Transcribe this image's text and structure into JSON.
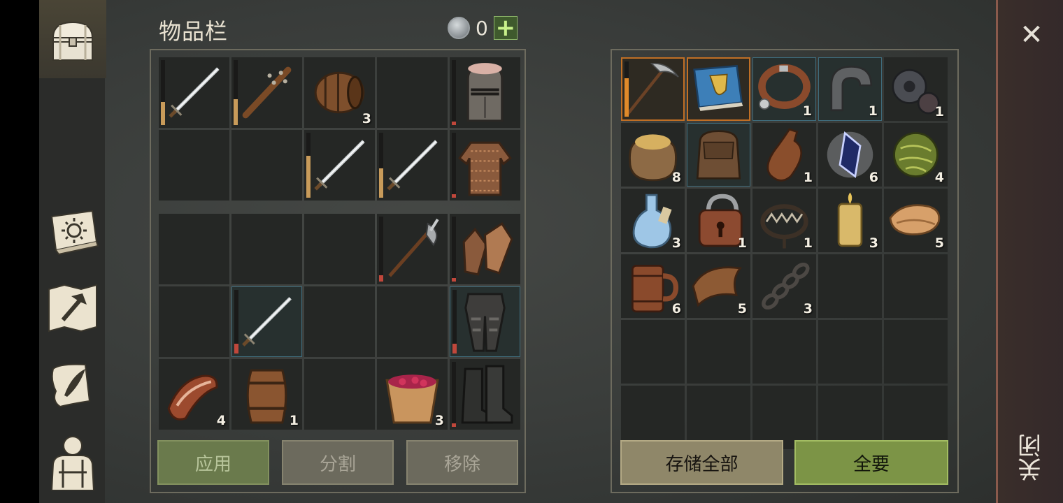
{
  "inventory": {
    "title": "物品栏",
    "currency": {
      "icon": "silver-coin-icon",
      "value": "0",
      "add": "+"
    },
    "equipped": [
      {
        "icon": "sword-icon",
        "count": "",
        "bar": 0.35,
        "bar_color": "#c89b5a"
      },
      {
        "icon": "spiked-club-icon",
        "count": "",
        "bar": 0.4,
        "bar_color": "#c89b5a"
      },
      {
        "icon": "barrel-icon",
        "count": "3",
        "bar": null,
        "bar_color": ""
      },
      {
        "icon": "",
        "count": "",
        "bar": null,
        "bar_color": ""
      },
      {
        "icon": "knight-helmet-icon",
        "count": "",
        "bar": 0.05,
        "bar_color": "#c0473b"
      },
      {
        "icon": "",
        "count": "",
        "bar": null,
        "bar_color": ""
      },
      {
        "icon": "",
        "count": "",
        "bar": null,
        "bar_color": ""
      },
      {
        "icon": "sword-icon",
        "count": "",
        "bar": 0.65,
        "bar_color": "#c89b5a"
      },
      {
        "icon": "sword-icon",
        "count": "",
        "bar": 0.45,
        "bar_color": "#c89b5a"
      },
      {
        "icon": "chainmail-shirt-icon",
        "count": "",
        "bar": 0.05,
        "bar_color": "#c0473b"
      }
    ],
    "backpack": [
      {
        "icon": "",
        "count": "",
        "bar": null,
        "bar_color": ""
      },
      {
        "icon": "",
        "count": "",
        "bar": null,
        "bar_color": ""
      },
      {
        "icon": "",
        "count": "",
        "bar": null,
        "bar_color": ""
      },
      {
        "icon": "halberd-icon",
        "count": "",
        "bar": 0.1,
        "bar_color": "#c0473b"
      },
      {
        "icon": "chainmail-gloves-icon",
        "count": "",
        "bar": 0.05,
        "bar_color": "#c0473b"
      },
      {
        "icon": "",
        "count": "",
        "bar": null,
        "bar_color": ""
      },
      {
        "icon": "sword-icon",
        "count": "",
        "bar": 0.15,
        "bar_color": "#c0473b",
        "sel": "blue"
      },
      {
        "icon": "",
        "count": "",
        "bar": null,
        "bar_color": ""
      },
      {
        "icon": "",
        "count": "",
        "bar": null,
        "bar_color": ""
      },
      {
        "icon": "armored-pants-icon",
        "count": "",
        "bar": 0.15,
        "bar_color": "#c0473b",
        "sel": "blue"
      },
      {
        "icon": "bacon-icon",
        "count": "4",
        "bar": null,
        "bar_color": ""
      },
      {
        "icon": "keg-icon",
        "count": "1",
        "bar": null,
        "bar_color": ""
      },
      {
        "icon": "",
        "count": "",
        "bar": null,
        "bar_color": ""
      },
      {
        "icon": "berry-bucket-icon",
        "count": "3",
        "bar": null,
        "bar_color": ""
      },
      {
        "icon": "leather-boots-icon",
        "count": "",
        "bar": 0.05,
        "bar_color": "#c0473b"
      }
    ],
    "buttons": {
      "apply": "应用",
      "split": "分割",
      "remove": "移除"
    }
  },
  "storage": {
    "items": [
      {
        "icon": "pickaxe-icon",
        "count": "",
        "sel": "orange",
        "bar": 0.7,
        "bar_color": "#e08a2a"
      },
      {
        "icon": "blue-book-icon",
        "count": "",
        "sel": "orange"
      },
      {
        "icon": "leather-collar-icon",
        "count": "1",
        "sel": "blue"
      },
      {
        "icon": "iron-clamp-icon",
        "count": "1",
        "sel": "blue"
      },
      {
        "icon": "gear-parts-icon",
        "count": "1"
      },
      {
        "icon": "grain-sack-icon",
        "count": "8"
      },
      {
        "icon": "leather-backpack-icon",
        "count": "",
        "sel": "blue"
      },
      {
        "icon": "clay-bottle-icon",
        "count": "1"
      },
      {
        "icon": "crystal-shard-icon",
        "count": "6"
      },
      {
        "icon": "herb-ball-icon",
        "count": "4"
      },
      {
        "icon": "potion-flask-icon",
        "count": "3"
      },
      {
        "icon": "padlock-icon",
        "count": "1"
      },
      {
        "icon": "bear-trap-icon",
        "count": "1"
      },
      {
        "icon": "candle-icon",
        "count": "3"
      },
      {
        "icon": "cloth-roll-icon",
        "count": "5"
      },
      {
        "icon": "wooden-mug-icon",
        "count": "6"
      },
      {
        "icon": "leather-scrap-icon",
        "count": "5"
      },
      {
        "icon": "chain-icon",
        "count": "3"
      },
      {
        "icon": "",
        "count": ""
      },
      {
        "icon": "",
        "count": ""
      },
      {
        "icon": "",
        "count": ""
      },
      {
        "icon": "",
        "count": ""
      },
      {
        "icon": "",
        "count": ""
      },
      {
        "icon": "",
        "count": ""
      },
      {
        "icon": "",
        "count": ""
      },
      {
        "icon": "",
        "count": ""
      },
      {
        "icon": "",
        "count": ""
      },
      {
        "icon": "",
        "count": ""
      },
      {
        "icon": "",
        "count": ""
      },
      {
        "icon": "",
        "count": ""
      }
    ],
    "buttons": {
      "store_all": "存储全部",
      "take_all": "全要"
    }
  },
  "rail": {
    "tabs": [
      {
        "icon": "chest-icon",
        "active": true
      },
      {
        "icon": "sun-book-icon"
      },
      {
        "icon": "crafting-map-icon"
      },
      {
        "icon": "quill-scroll-icon"
      },
      {
        "icon": "character-armor-icon"
      }
    ]
  },
  "close": {
    "x": "✕",
    "label": "关闭"
  }
}
